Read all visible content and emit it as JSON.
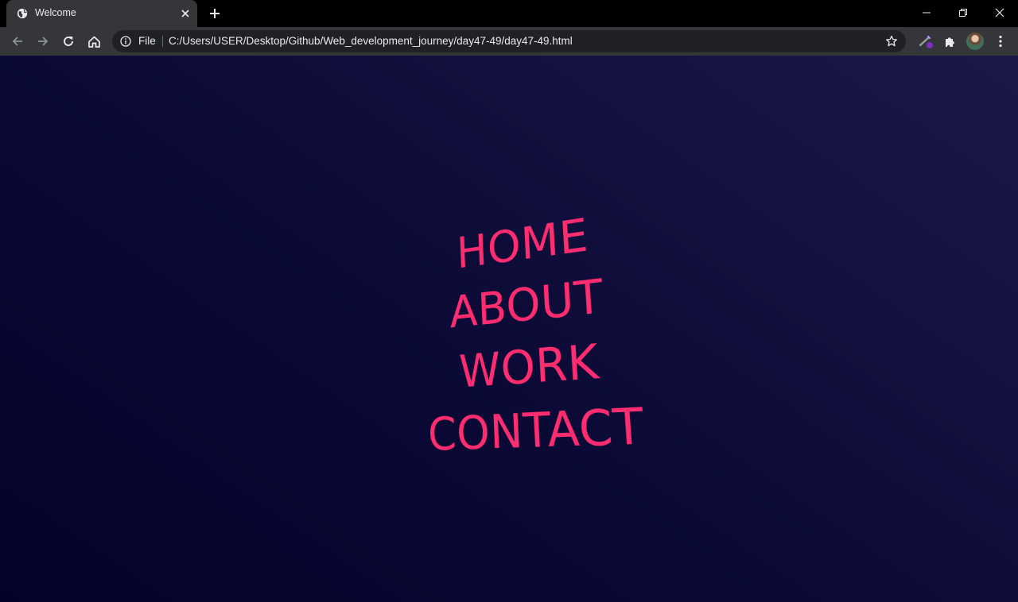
{
  "browser": {
    "tab": {
      "title": "Welcome"
    },
    "omnibox": {
      "scheme_label": "File",
      "url": "C:/Users/USER/Desktop/Github/Web_development_journey/day47-49/day47-49.html"
    }
  },
  "page": {
    "menu": [
      {
        "label": "HOME"
      },
      {
        "label": "ABOUT"
      },
      {
        "label": "WORK"
      },
      {
        "label": "CONTACT"
      }
    ],
    "colors": {
      "link": "#ff2d6f",
      "background_top_right": "#1b1848",
      "background_bottom_left": "#03032a"
    }
  },
  "icons": {
    "favicon": "globe-icon",
    "tab_close": "close-icon",
    "new_tab": "plus-icon",
    "back": "arrow-left-icon",
    "forward": "arrow-right-icon",
    "reload": "reload-icon",
    "home": "home-icon",
    "site_info": "info-icon",
    "bookmark": "star-icon",
    "extension_pen": "pen-extension-icon",
    "extensions": "puzzle-icon",
    "menu": "kebab-menu-icon"
  }
}
